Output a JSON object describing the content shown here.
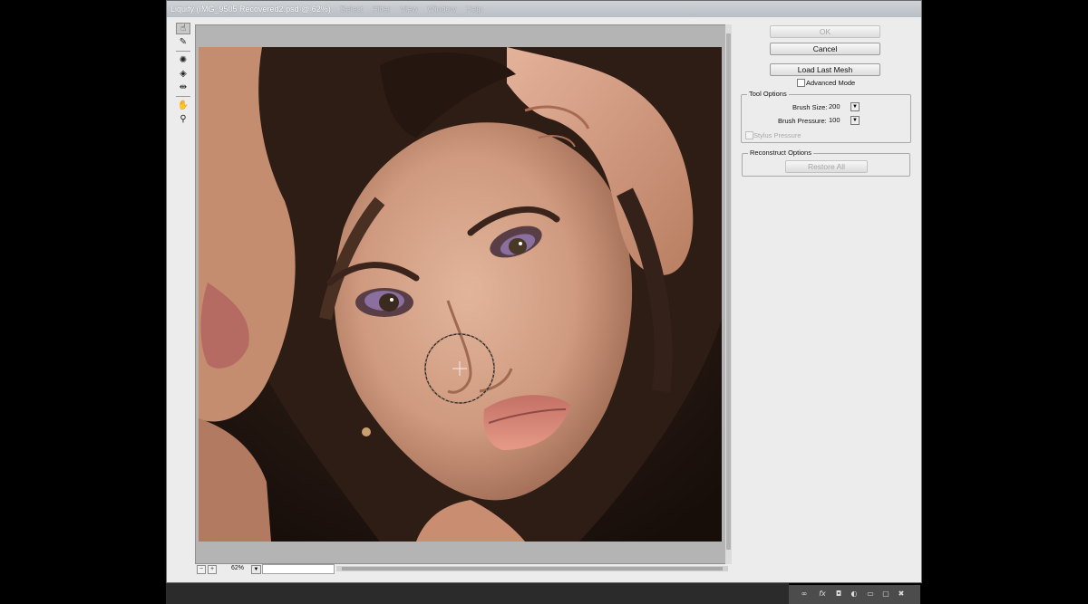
{
  "window": {
    "title": "Liquify (IMG_9505 Recovered2.psd @ 62%)",
    "ghost_menu": [
      "Select",
      "Filter",
      "View",
      "Window",
      "Help"
    ]
  },
  "toolbar": {
    "tools": [
      {
        "name": "forward-warp-tool-icon",
        "glyph": "☝",
        "active": true
      },
      {
        "name": "reconstruct-tool-icon",
        "glyph": "✎",
        "active": false
      },
      {
        "name": "pucker-tool-icon",
        "glyph": "✺",
        "active": false
      },
      {
        "name": "bloat-tool-icon",
        "glyph": "◈",
        "active": false
      },
      {
        "name": "push-left-tool-icon",
        "glyph": "⇹",
        "active": false
      },
      {
        "name": "hand-tool-icon",
        "glyph": "✋",
        "active": false
      },
      {
        "name": "zoom-tool-icon",
        "glyph": "⚲",
        "active": false
      }
    ]
  },
  "canvas": {
    "zoom_value": "62%"
  },
  "panel": {
    "ok_label": "OK",
    "cancel_label": "Cancel",
    "load_last_mesh_label": "Load Last Mesh",
    "advanced_mode_label": "Advanced Mode",
    "tool_options": {
      "title": "Tool Options",
      "brush_size_label": "Brush Size:",
      "brush_size_value": "200",
      "brush_pressure_label": "Brush Pressure:",
      "brush_pressure_value": "100",
      "stylus_pressure_label": "Stylus Pressure"
    },
    "reconstruct_options": {
      "title": "Reconstruct Options",
      "restore_all_label": "Restore All"
    }
  },
  "layers_strip": {
    "icons": [
      "link-icon",
      "fx-icon",
      "mask-icon",
      "adjustment-icon",
      "folder-icon",
      "new-layer-icon",
      "trash-icon"
    ]
  }
}
